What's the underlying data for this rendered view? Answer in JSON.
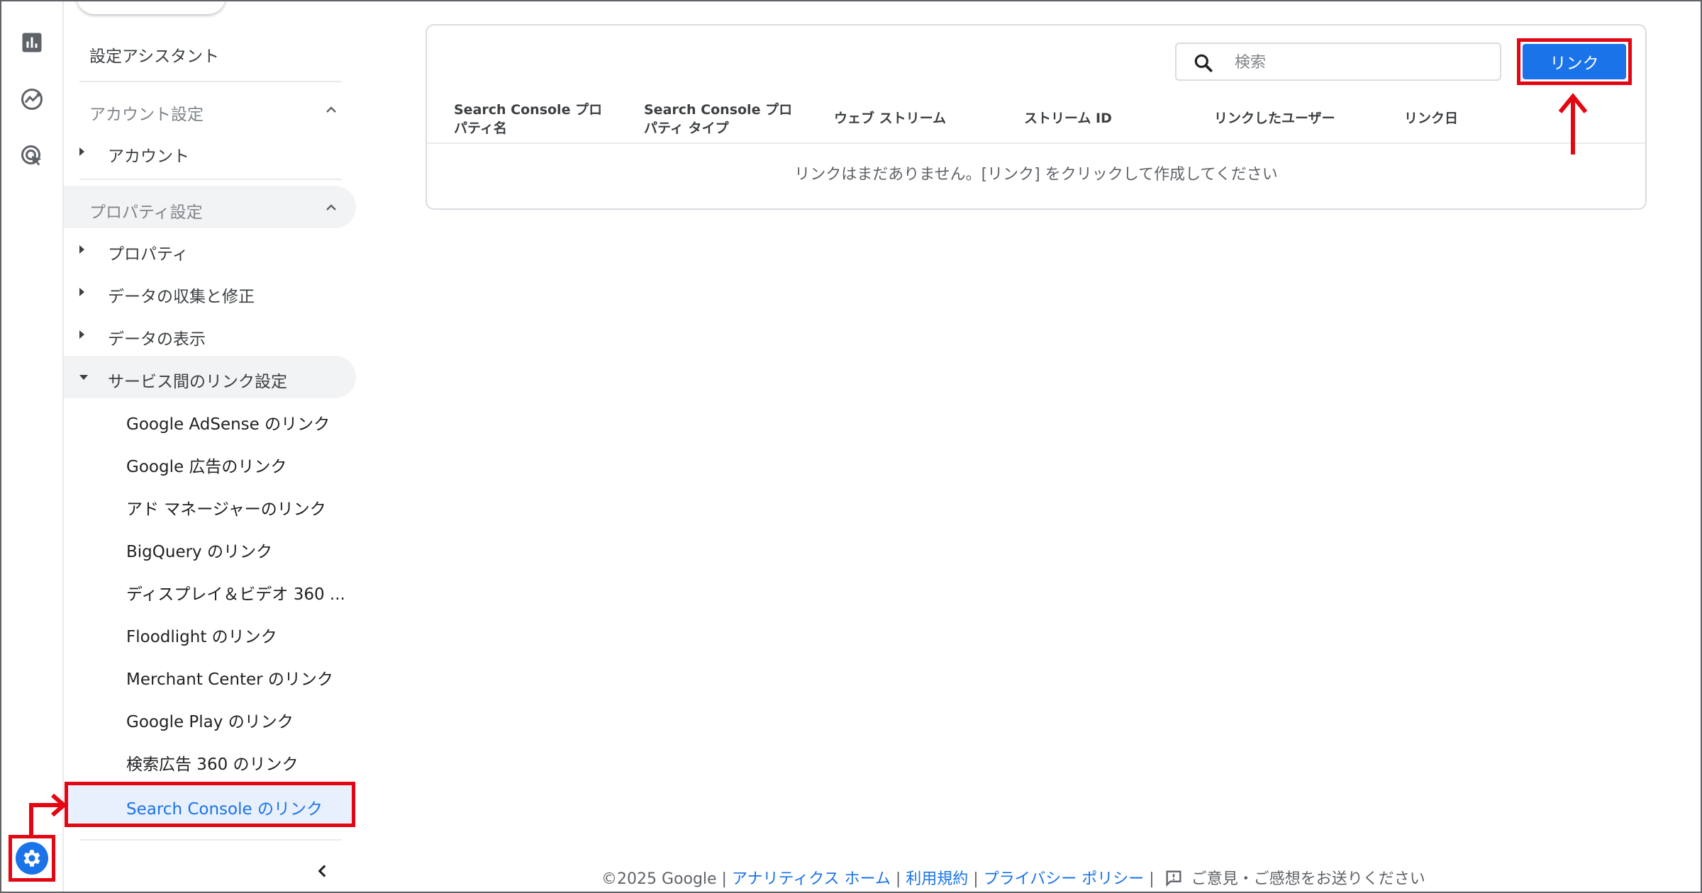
{
  "colors": {
    "accent": "#1a73e8",
    "highlight_red": "#e30613"
  },
  "rail": {
    "icons": [
      "reports-icon",
      "explore-icon",
      "advertising-icon"
    ],
    "settings_icon": "gear-icon"
  },
  "sidebar": {
    "setup_assistant": "設定アシスタント",
    "account_section": "アカウント設定",
    "account_item": "アカウント",
    "property_section": "プロパティ設定",
    "property_item": "プロパティ",
    "data_collection": "データの収集と修正",
    "data_display": "データの表示",
    "product_links": "サービス間のリンク設定",
    "links": [
      "Google AdSense のリンク",
      "Google 広告のリンク",
      "アド マネージャーのリンク",
      "BigQuery のリンク",
      "ディスプレイ＆ビデオ 360 ...",
      "Floodlight のリンク",
      "Merchant Center のリンク",
      "Google Play のリンク",
      "検索広告 360 のリンク"
    ],
    "active_link": "Search Console のリンク"
  },
  "main": {
    "search_placeholder": "検索",
    "link_button": "リンク",
    "columns": [
      [
        "Search Console プロ",
        "パティ名"
      ],
      [
        "Search Console プロ",
        "パティ タイプ"
      ],
      [
        "ウェブ ストリーム"
      ],
      [
        "ストリーム ID"
      ],
      [
        "リンクしたユーザー"
      ],
      [
        "リンク日"
      ]
    ],
    "empty_message": "リンクはまだありません。[リンク] をクリックして作成してください"
  },
  "footer": {
    "copyright": "©2025 Google",
    "analytics_home": "アナリティクス ホーム",
    "terms": "利用規約",
    "privacy": "プライバシー ポリシー",
    "feedback": "ご意見・ご感想をお送りください"
  }
}
